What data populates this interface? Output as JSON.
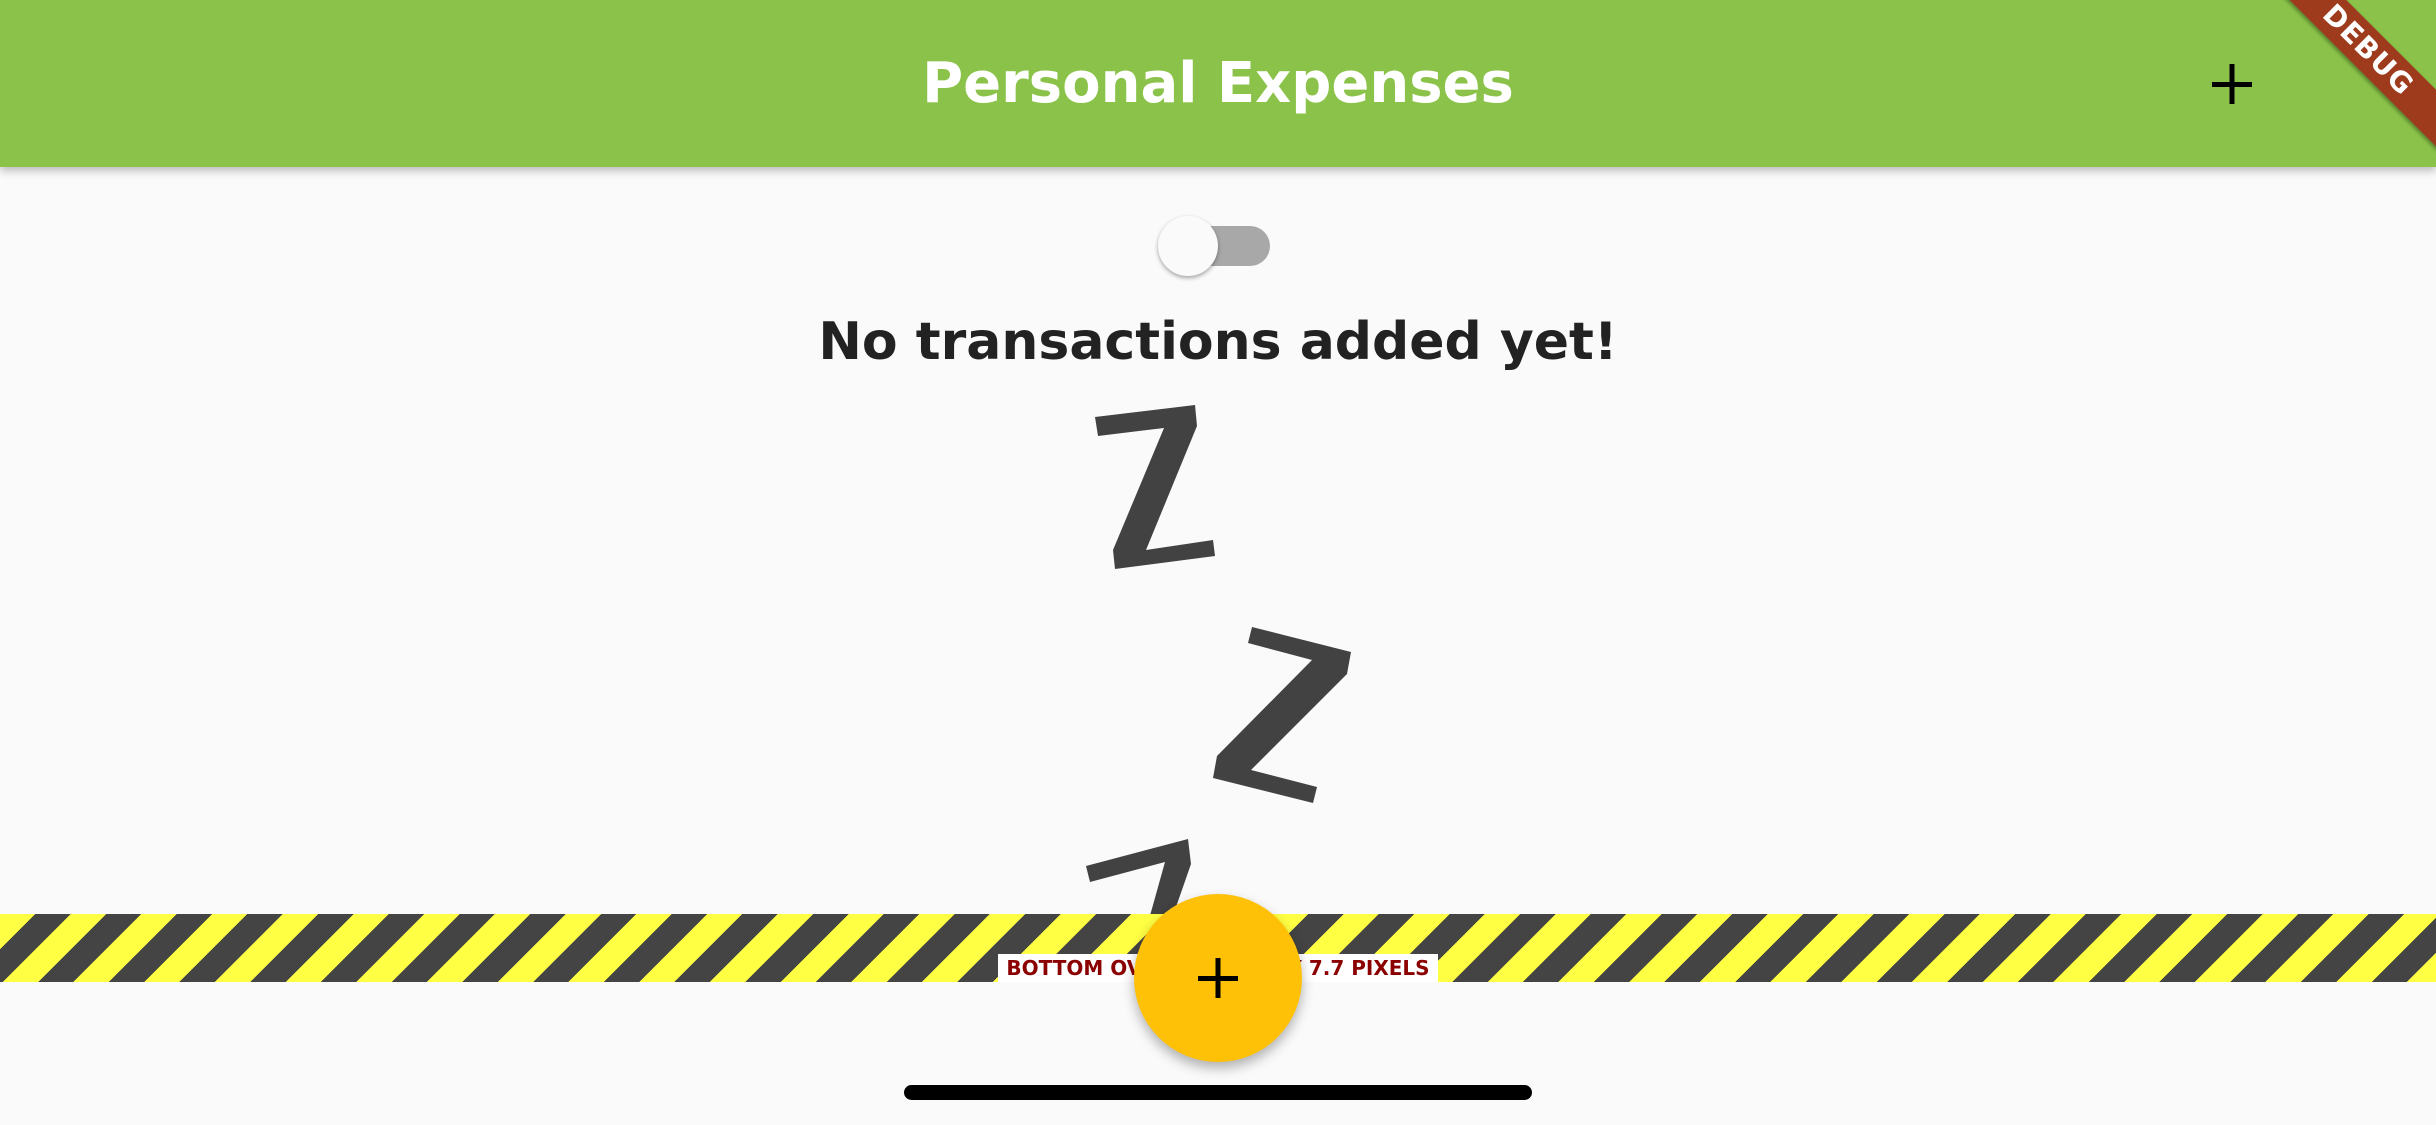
{
  "app_bar": {
    "title": "Personal Expenses",
    "background_color": "#8bc34a",
    "action_icon": "plus-icon"
  },
  "debug_banner": {
    "label": "DEBUG",
    "color": "#9e3b1c"
  },
  "chart_switch": {
    "state": "off"
  },
  "empty_state": {
    "message": "No transactions added yet!",
    "image": "sleeping-zzz-image"
  },
  "overflow_warning": {
    "label": "BOTTOM OVERFLOWED BY 7.7 PIXELS",
    "stripe_colors": [
      "#ffff44",
      "#444444"
    ],
    "text_color": "#8b0000"
  },
  "fab": {
    "icon": "plus-icon",
    "color": "#ffc107"
  }
}
